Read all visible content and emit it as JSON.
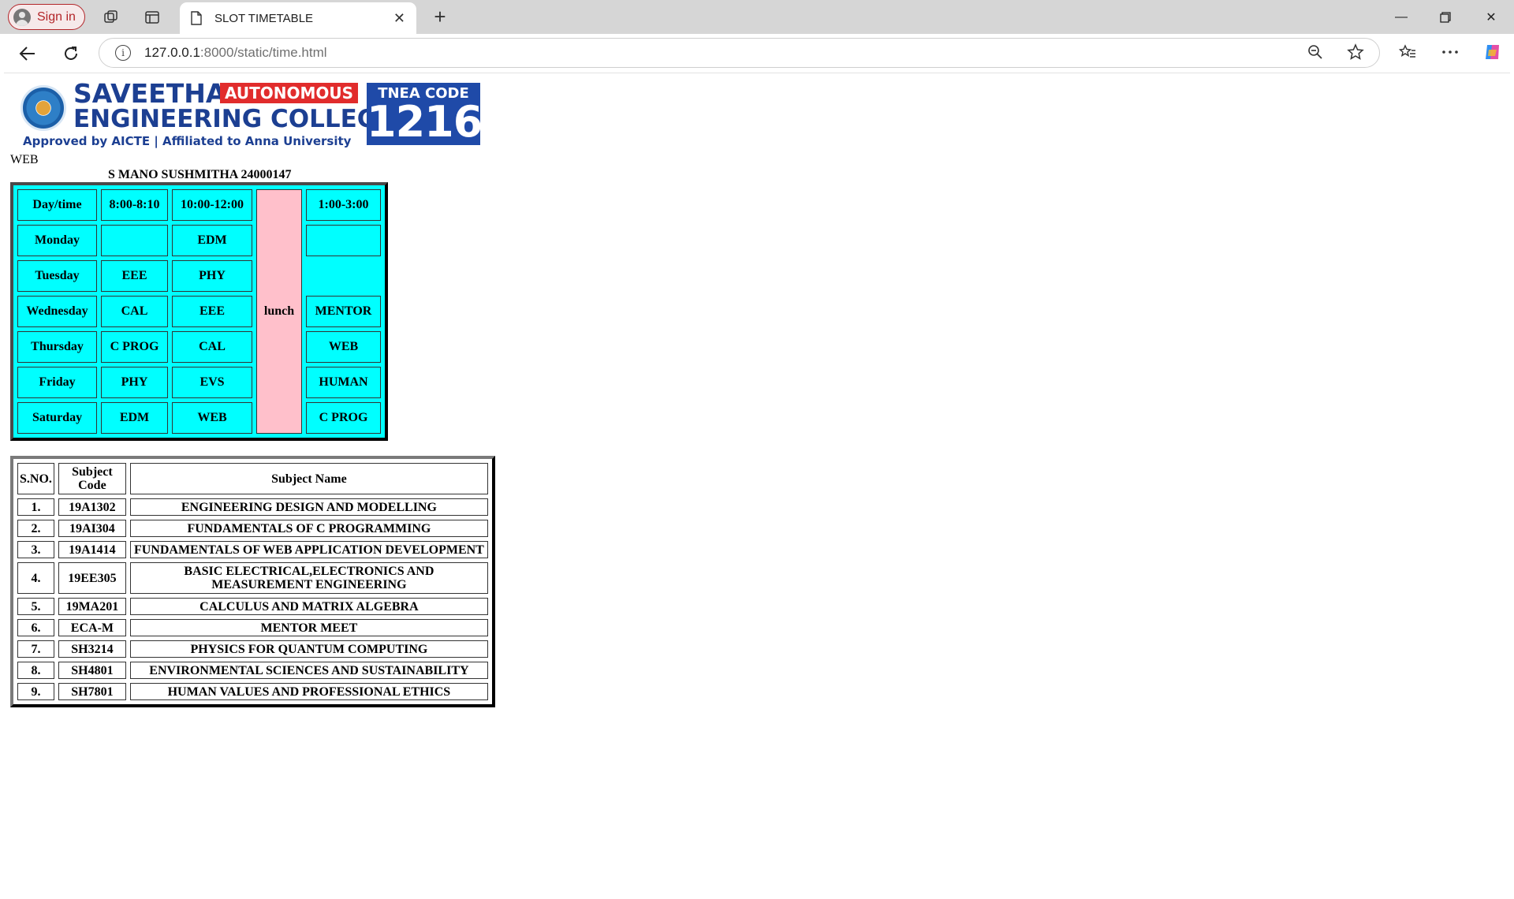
{
  "browser": {
    "signin_label": "Sign in",
    "tab_title": "SLOT TIMETABLE",
    "url_host": "127.0.0.1",
    "url_rest": ":8000/static/time.html"
  },
  "logo": {
    "name_line1": "SAVEETHA",
    "badge": "AUTONOMOUS",
    "name_line2": "ENGINEERING COLLEGE",
    "approval": "Approved by AICTE  |  Affiliated to Anna University",
    "tnea_label": "TNEA CODE",
    "tnea_code": "1216"
  },
  "page": {
    "web_label": "WEB",
    "student": "S MANO SUSHMITHA 24000147"
  },
  "timetable": {
    "headers": [
      "Day/time",
      "8:00-8:10",
      "10:00-12:00",
      "1:00-3:00"
    ],
    "lunch": "lunch",
    "rows": [
      {
        "day": "Monday",
        "s1": "",
        "s2": "EDM",
        "s3": ""
      },
      {
        "day": "Tuesday",
        "s1": "EEE",
        "s2": "PHY",
        "s3": ""
      },
      {
        "day": "Wednesday",
        "s1": "CAL",
        "s2": "EEE",
        "s3": "MENTOR"
      },
      {
        "day": "Thursday",
        "s1": "C PROG",
        "s2": "CAL",
        "s3": "WEB"
      },
      {
        "day": "Friday",
        "s1": "PHY",
        "s2": "EVS",
        "s3": "HUMAN"
      },
      {
        "day": "Saturday",
        "s1": "EDM",
        "s2": "WEB",
        "s3": "C PROG"
      }
    ]
  },
  "subjects": {
    "headers": [
      "S.NO.",
      "Subject Code",
      "Subject Name"
    ],
    "rows": [
      {
        "sno": "1.",
        "code": "19A1302",
        "name": "ENGINEERING DESIGN AND MODELLING"
      },
      {
        "sno": "2.",
        "code": "19AI304",
        "name": "FUNDAMENTALS OF C PROGRAMMING"
      },
      {
        "sno": "3.",
        "code": "19A1414",
        "name": "FUNDAMENTALS OF WEB APPLICATION DEVELOPMENT"
      },
      {
        "sno": "4.",
        "code": "19EE305",
        "name": "BASIC ELECTRICAL,ELECTRONICS AND MEASUREMENT ENGINEERING"
      },
      {
        "sno": "5.",
        "code": "19MA201",
        "name": "CALCULUS AND MATRIX ALGEBRA"
      },
      {
        "sno": "6.",
        "code": "ECA-M",
        "name": "MENTOR MEET"
      },
      {
        "sno": "7.",
        "code": "SH3214",
        "name": "PHYSICS FOR QUANTUM COMPUTING"
      },
      {
        "sno": "8.",
        "code": "SH4801",
        "name": "ENVIRONMENTAL SCIENCES AND SUSTAINABILITY"
      },
      {
        "sno": "9.",
        "code": "SH7801",
        "name": "HUMAN VALUES AND PROFESSIONAL ETHICS"
      }
    ]
  }
}
